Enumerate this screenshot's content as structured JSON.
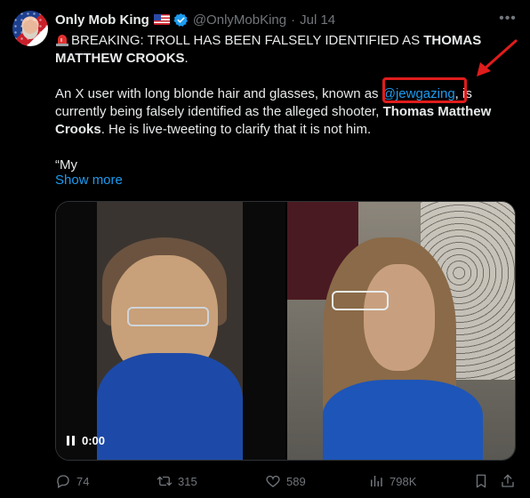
{
  "author": {
    "display_name": "Only Mob King",
    "handle": "@OnlyMobKing",
    "separator": "·",
    "date": "Jul 14"
  },
  "tweet": {
    "line1_text": "BREAKING: TROLL HAS BEEN FALSELY IDENTIFIED AS ",
    "line1_bold": "THOMAS",
    "line2_bold": "MATTHEW CROOKS",
    "line2_end": ".",
    "p2_l1_start": "An X user with long blonde hair and glasses, known as ",
    "mention": "@jewgazing",
    "p2_l1_end": ", is",
    "p2_l2_start": "currently being falsely identified as the alleged shooter, ",
    "p2_l2_bold": "Thomas Matthew",
    "p2_l3_bold": "Crooks",
    "p2_l3_end": ". He is live-tweeting to clarify that it is not him.",
    "p3": "“My",
    "show_more": "Show more"
  },
  "video": {
    "time": "0:00"
  },
  "actions": {
    "replies": "74",
    "reposts": "315",
    "likes": "589",
    "views": "798K"
  },
  "colors": {
    "accent": "#1d9bf0",
    "annotation_red": "#e01c1c",
    "background": "#000000",
    "muted": "#71767b"
  },
  "icons": [
    "siren-icon",
    "verified-badge-icon",
    "us-flag-icon",
    "more-icon",
    "reply-icon",
    "repost-icon",
    "like-icon",
    "views-icon",
    "bookmark-icon",
    "share-icon",
    "pause-icon",
    "arrow-annotation"
  ]
}
